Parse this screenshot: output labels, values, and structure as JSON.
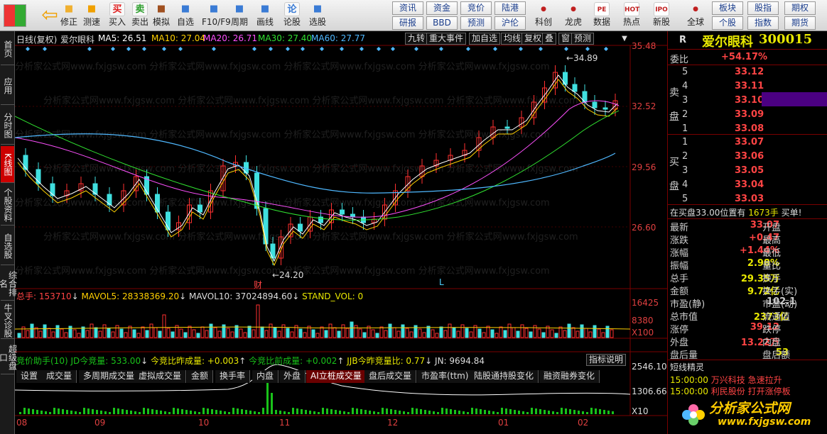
{
  "toolbar": {
    "buttons": [
      {
        "label": "修正",
        "icon": "up-arrow-icon"
      },
      {
        "label": "测速",
        "icon": "speed-icon"
      },
      {
        "label": "买入",
        "icon": "buy-icon",
        "glyph": "买"
      },
      {
        "label": "卖出",
        "icon": "sell-icon",
        "glyph": "卖"
      },
      {
        "label": "模拟",
        "icon": "hammer-icon"
      },
      {
        "label": "自选",
        "icon": "star-icon"
      },
      {
        "label": "F10/F9",
        "icon": "f10-icon"
      },
      {
        "label": "周期",
        "icon": "period-icon"
      },
      {
        "label": "画线",
        "icon": "pen-icon"
      },
      {
        "label": "论股",
        "icon": "chat-icon",
        "glyph": "论"
      },
      {
        "label": "选股",
        "icon": "magnifier-icon"
      }
    ],
    "small_buttons_row1": [
      "资讯",
      "资金",
      "竞价",
      "陆港"
    ],
    "small_buttons_row2": [
      "研报",
      "BBD",
      "预测",
      "沪伦"
    ],
    "buttons2": [
      {
        "label": "科创",
        "icon": "tech-icon"
      },
      {
        "label": "龙虎",
        "icon": "dragon-icon"
      },
      {
        "label": "数据",
        "icon": "pe-icon",
        "glyph": "PE"
      },
      {
        "label": "热点",
        "icon": "hot-icon",
        "glyph": "HOT"
      },
      {
        "label": "新股",
        "icon": "ipo-icon",
        "glyph": "IPO"
      },
      {
        "label": "全球",
        "icon": "globe-icon"
      }
    ],
    "right_buttons": [
      "板块",
      "股指",
      "期权",
      "个股",
      "指数",
      "期货"
    ]
  },
  "leftnav": [
    "首页",
    "应用",
    "分时图",
    "K线图",
    "个股资料",
    "自选股",
    "综合排名",
    "牛叉诊股",
    "超级盘口"
  ],
  "chart": {
    "title": "日线(复权)",
    "stock_name": "爱尔眼科",
    "ma_labels": [
      {
        "text": "MA5: 26.51",
        "color": "#ffffff"
      },
      {
        "text": "MA10: 27.04",
        "color": "#ffd000"
      },
      {
        "text": "MA20: 26.71",
        "color": "#ff50ff"
      },
      {
        "text": "MA30: 27.40",
        "color": "#30e030"
      },
      {
        "text": "MA60: 27.77",
        "color": "#4fb8ff"
      }
    ],
    "controls": [
      "九转",
      "重大事件",
      "加自选",
      "均线",
      "复权",
      "叠",
      "窗",
      "预测"
    ],
    "price_axis": [
      "35.48",
      "32.52",
      "29.56",
      "26.60"
    ],
    "high_label": "34.89",
    "low_label": "24.20",
    "event_mark": "财",
    "l_mark": "L",
    "volume": {
      "label": "总手: 153710",
      "mavol5": "MAVOL5: 28338369.20",
      "mavol10": "MAVOL10: 37024894.60",
      "stand": "STAND_VOL: 0",
      "axis": [
        "16425",
        "8380",
        "X100"
      ]
    },
    "tabs": [
      "设置",
      "成交量",
      "多周期成交量",
      "虚拟成交量",
      "金额",
      "换手率",
      "内盘",
      "外盘",
      "AI立桩成交量",
      "盘后成交量",
      "市盈率(ttm)",
      "陆股通持股变化",
      "融资融券变化"
    ],
    "active_tab": "AI立桩成交量",
    "auction": {
      "label": "竞价助手(10) JD今竞量: 533.00",
      "a2": "今竞比昨成量: +0.003",
      "a3": "今竞比前成量: +0.002",
      "a4": "JJB今昨竞量比: 0.77",
      "a5": "JN: 9694.84",
      "button": "指标说明",
      "axis": [
        "2546.10",
        "1306.66",
        "X10"
      ]
    },
    "months": [
      "08",
      "09",
      "10",
      "11",
      "12",
      "01",
      "02"
    ],
    "watermark": "分析家公式网www.fxjgsw.com"
  },
  "panel": {
    "market": "R",
    "name": "爱尔眼科",
    "code": "300015",
    "weibi_label": "委比",
    "weibi": "+54.17%",
    "sell_label": "卖盘",
    "buy_label": "买盘",
    "asks": [
      {
        "lv": "5",
        "price": "33.12"
      },
      {
        "lv": "4",
        "price": "33.11"
      },
      {
        "lv": "3",
        "price": "33.10"
      },
      {
        "lv": "2",
        "price": "33.09"
      },
      {
        "lv": "1",
        "price": "33.08"
      }
    ],
    "bids": [
      {
        "lv": "1",
        "price": "33.07"
      },
      {
        "lv": "2",
        "price": "33.06"
      },
      {
        "lv": "3",
        "price": "33.05"
      },
      {
        "lv": "4",
        "price": "33.04"
      },
      {
        "lv": "5",
        "price": "33.03"
      }
    ],
    "buy_notice": "在买盘33.00位置有",
    "buy_notice_qty": "1673手",
    "buy_notice_tail": "买单!",
    "stats": [
      {
        "l": "最新",
        "v": "33.07",
        "r": "开盘",
        "c": "red"
      },
      {
        "l": "涨跌",
        "v": "+0.47",
        "r": "最高",
        "c": "red"
      },
      {
        "l": "涨幅",
        "v": "+1.44%",
        "r": "最低",
        "c": "red"
      },
      {
        "l": "振幅",
        "v": "2.98%",
        "r": "量比",
        "c": "yel"
      },
      {
        "l": "总手",
        "v": "29.35万",
        "r": "换手",
        "c": "yel"
      },
      {
        "l": "金额",
        "v": "9.72亿",
        "r": "换手(实)",
        "c": "yel"
      },
      {
        "l": "市盈(静)",
        "v": "102.1",
        "r": "市盈(动)",
        "c": "lab"
      },
      {
        "l": "总市值",
        "v": "2373亿",
        "r": "流通值",
        "c": "yel"
      },
      {
        "l": "涨停",
        "v": "39.12",
        "r": "跌停",
        "c": "red"
      },
      {
        "l": "外盘",
        "v": "13.22万",
        "r": "内盘",
        "c": "red"
      },
      {
        "l": "盘后量",
        "v": "53",
        "r": "盘后额",
        "c": "yel"
      }
    ],
    "sprite_title": "短线精灵",
    "sprites": [
      {
        "t": "15:00:00",
        "n": "万兴科技",
        "e": "急速拉升"
      },
      {
        "t": "15:00:00",
        "n": "利民股份",
        "e": "打开涨停板"
      }
    ],
    "logo": "分析家公式网",
    "logo_url": "www.fxjgsw.com"
  }
}
